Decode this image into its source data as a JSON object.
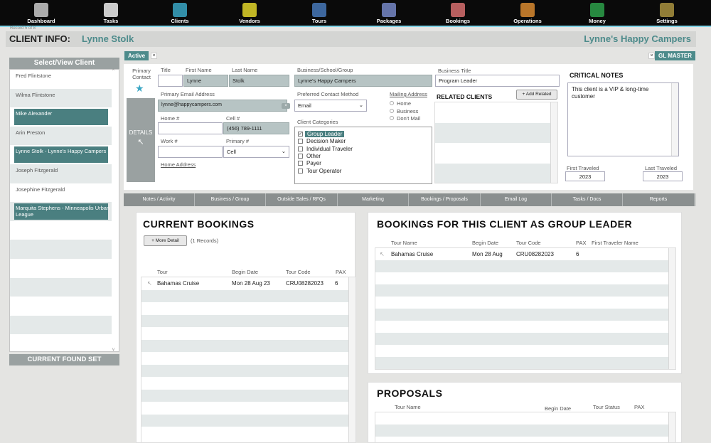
{
  "nav": [
    {
      "label": "Dashboard",
      "icon": "dashboard-icon",
      "color": "#c9c9c9"
    },
    {
      "label": "Tasks",
      "icon": "tasks-icon",
      "color": "#ededed"
    },
    {
      "label": "Clients",
      "icon": "clients-icon",
      "color": "#3aa6c4"
    },
    {
      "label": "Vendors",
      "icon": "vendors-icon",
      "color": "#e2d52a"
    },
    {
      "label": "Tours",
      "icon": "tours-icon",
      "color": "#4678b8"
    },
    {
      "label": "Packages",
      "icon": "packages-icon",
      "color": "#7587c6"
    },
    {
      "label": "Bookings",
      "icon": "bookings-icon",
      "color": "#d66e6e"
    },
    {
      "label": "Operations",
      "icon": "operations-icon",
      "color": "#d88a30"
    },
    {
      "label": "Money",
      "icon": "money-icon",
      "color": "#2da04a"
    },
    {
      "label": "Settings",
      "icon": "settings-icon",
      "color": "#a9923f"
    }
  ],
  "record_of": "Record 5 of 8",
  "header": {
    "label": "CLIENT INFO:",
    "client_name": "Lynne Stolk",
    "business": "Lynne's Happy Campers"
  },
  "left_panel": {
    "title": "Select/View Client",
    "clients": [
      {
        "name": "Fred Flintstone",
        "selected": false
      },
      {
        "name": "Wilma Flintstone",
        "selected": false
      },
      {
        "name": "Mike Alexander",
        "selected": true
      },
      {
        "name": "Arin Preston",
        "selected": false
      },
      {
        "name": "Lynne Stolk - Lynne's Happy Campers",
        "selected": true
      },
      {
        "name": "Joseph Fitzgerald",
        "selected": false
      },
      {
        "name": "Josephine Fitzgerald",
        "selected": false
      },
      {
        "name": "Marquita Stephens - Minneapolis Urban League",
        "selected": true
      },
      {
        "name": "",
        "selected": false
      },
      {
        "name": "",
        "selected": false
      },
      {
        "name": "",
        "selected": false
      },
      {
        "name": "",
        "selected": false
      },
      {
        "name": "",
        "selected": false
      },
      {
        "name": "",
        "selected": false
      },
      {
        "name": "",
        "selected": false
      }
    ],
    "found_set_label": "CURRENT FOUND SET"
  },
  "status_badge": "Active",
  "gl_master_label": "GL MASTER",
  "contact": {
    "primary_contact_label": "Primary Contact",
    "title_label": "Title",
    "title": "",
    "first_name_label": "First Name",
    "first_name": "Lynne",
    "last_name_label": "Last Name",
    "last_name": "Stolk",
    "business_label": "Business/School/Group",
    "business": "Lynne's Happy Campers",
    "business_title_label": "Business Title",
    "business_title": "Program Leader",
    "email_label": "Primary Email Address",
    "email": "lynne@happycampers.com",
    "pref_contact_label": "Preferred Contact Method",
    "pref_contact": "Email",
    "mailing_label": "Mailing Address",
    "mailing_options": [
      "Home",
      "Business",
      "Don't Mail"
    ],
    "home_label": "Home #",
    "home": "",
    "cell_label": "Cell #",
    "cell": "(456) 789-1111",
    "work_label": "Work #",
    "work": "",
    "primary_label": "Primary #",
    "primary": "Cell",
    "home_address_link": "Home Address",
    "details_label": "DETAILS",
    "categories_label": "Client Categories",
    "categories": [
      {
        "label": "Group Leader",
        "checked": true
      },
      {
        "label": "Decision Maker",
        "checked": false
      },
      {
        "label": "Individual Traveler",
        "checked": false
      },
      {
        "label": "Other",
        "checked": false
      },
      {
        "label": "Payer",
        "checked": false
      },
      {
        "label": "Tour Operator",
        "checked": false
      }
    ]
  },
  "related": {
    "title": "RELATED CLIENTS",
    "add_label": "Add Related"
  },
  "notes": {
    "title": "CRITICAL NOTES",
    "text": "This client is a VIP & long-time customer",
    "first_traveled_label": "First Traveled",
    "first_traveled": "2023",
    "last_traveled_label": "Last Traveled",
    "last_traveled": "2023"
  },
  "tabs": [
    "Notes / Activity",
    "Business / Group",
    "Outside Sales / RFQs",
    "Marketing",
    "Bookings / Proposals",
    "Email Log",
    "Tasks / Docs",
    "Reports"
  ],
  "current_bookings": {
    "title": "CURRENT BOOKINGS",
    "more_detail": "More Detail",
    "records": "(1 Records)",
    "columns": [
      "Tour",
      "Begin Date",
      "Tour Code",
      "PAX"
    ],
    "rows": [
      {
        "tour": "Bahamas Cruise",
        "begin": "Mon 28 Aug 23",
        "code": "CRU08282023",
        "pax": "6"
      }
    ]
  },
  "group_leader": {
    "title": "BOOKINGS FOR THIS CLIENT AS GROUP LEADER",
    "columns": [
      "Tour Name",
      "Begin Date",
      "Tour Code",
      "PAX",
      "First Traveler Name"
    ],
    "rows": [
      {
        "tour": "Bahamas Cruise",
        "begin": "Mon 28 Aug",
        "code": "CRU08282023",
        "pax": "6",
        "first": ""
      }
    ]
  },
  "proposals": {
    "title": "PROPOSALS",
    "columns": [
      "Tour Name",
      "Begin Date",
      "Tour Status",
      "PAX"
    ]
  }
}
